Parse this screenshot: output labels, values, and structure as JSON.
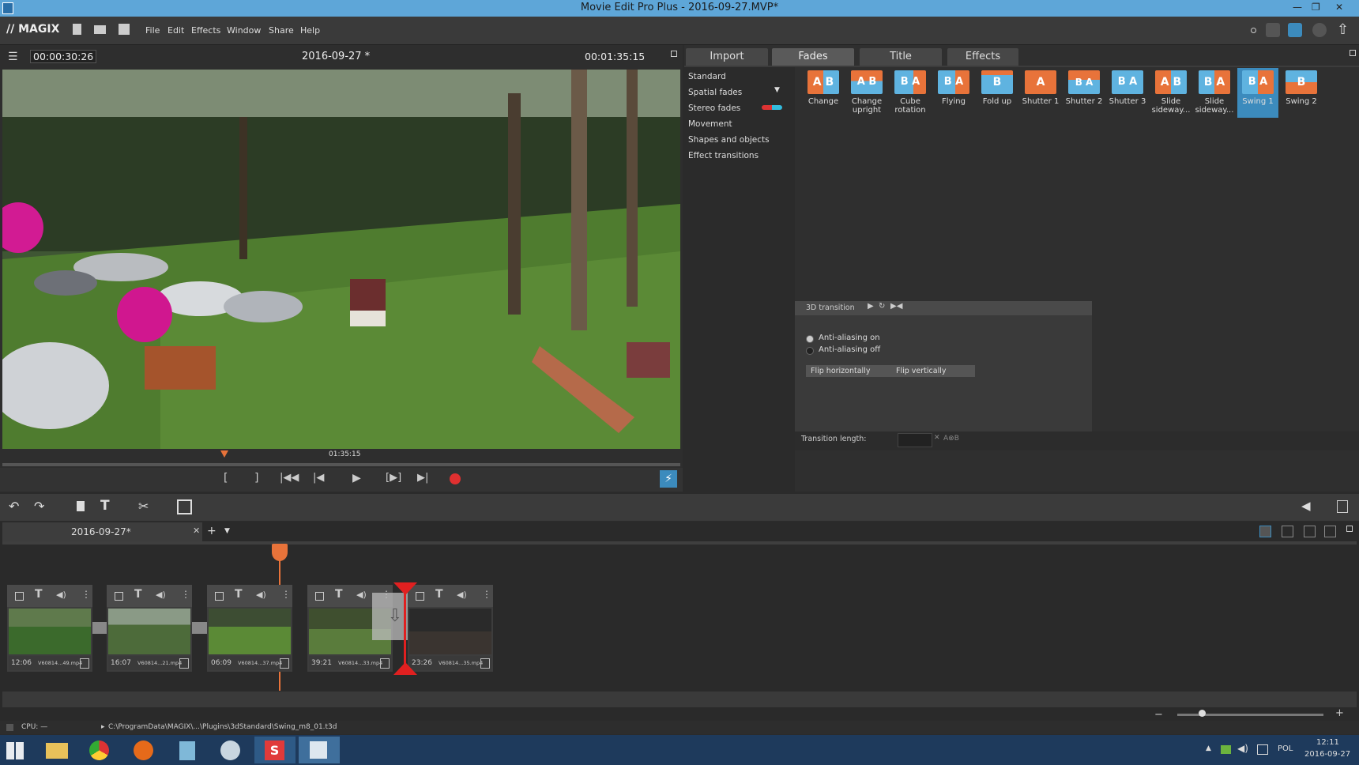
{
  "window": {
    "title": "Movie Edit Pro Plus - 2016-09-27.MVP*"
  },
  "menubar": {
    "logo": "MAGIX",
    "items": [
      "File",
      "Edit",
      "Effects",
      "Window",
      "Share",
      "Help"
    ]
  },
  "preview": {
    "timecode_current": "00:00:30:26",
    "project_name": "2016-09-27 *",
    "timecode_total": "00:01:35:15",
    "scrub_time": "01:35:15"
  },
  "right_panel": {
    "tabs": [
      "Import",
      "Fades",
      "Title",
      "Effects"
    ],
    "active_tab": "Fades",
    "categories": [
      "Standard",
      "Spatial fades",
      "Stereo fades",
      "Movement",
      "Shapes and objects",
      "Effect transitions"
    ],
    "effects": [
      {
        "label1": "Change",
        "label2": "",
        "letters": "A B"
      },
      {
        "label1": "Change",
        "label2": "upright",
        "letters": "A B"
      },
      {
        "label1": "Cube",
        "label2": "rotation",
        "letters": "B A"
      },
      {
        "label1": "Flying",
        "label2": "",
        "letters": "B A"
      },
      {
        "label1": "Fold up",
        "label2": "",
        "letters": "B"
      },
      {
        "label1": "Shutter 1",
        "label2": "",
        "letters": "A"
      },
      {
        "label1": "Shutter 2",
        "label2": "",
        "letters": "B A"
      },
      {
        "label1": "Shutter 3",
        "label2": "",
        "letters": "B A"
      },
      {
        "label1": "Slide",
        "label2": "sideway...",
        "letters": "A B"
      },
      {
        "label1": "Slide",
        "label2": "sideway...",
        "letters": "B A"
      },
      {
        "label1": "Swing 1",
        "label2": "",
        "letters": "B A"
      },
      {
        "label1": "Swing 2",
        "label2": "",
        "letters": "B"
      }
    ],
    "selected_effect": "Swing 1",
    "settings": {
      "header": "3D transition",
      "radio_on": "Anti-aliasing on",
      "radio_off": "Anti-aliasing off",
      "flip_h": "Flip horizontally",
      "flip_v": "Flip vertically",
      "transition_length_label": "Transition length:",
      "ab_label": "A⊗B"
    }
  },
  "timeline": {
    "tab_name": "2016-09-27*",
    "clips": [
      {
        "time": "12:06",
        "file": "V60814...49.mp4"
      },
      {
        "time": "16:07",
        "file": "V60814...21.mp4"
      },
      {
        "time": "06:09",
        "file": "V60814...37.mp4"
      },
      {
        "time": "39:21",
        "file": "V60814...33.mp4"
      },
      {
        "time": "23:26",
        "file": "V60814...35.mp4"
      }
    ]
  },
  "status": {
    "cpu": "CPU: —",
    "path": "C:\\ProgramData\\MAGIX\\...\\Plugins\\3dStandard\\Swing_m8_01.t3d"
  },
  "taskbar": {
    "lang": "POL",
    "time": "12:11",
    "date": "2016-09-27"
  },
  "colors": {
    "accent": "#3c8bbd",
    "orange": "#e8733a",
    "record": "#e03030"
  }
}
